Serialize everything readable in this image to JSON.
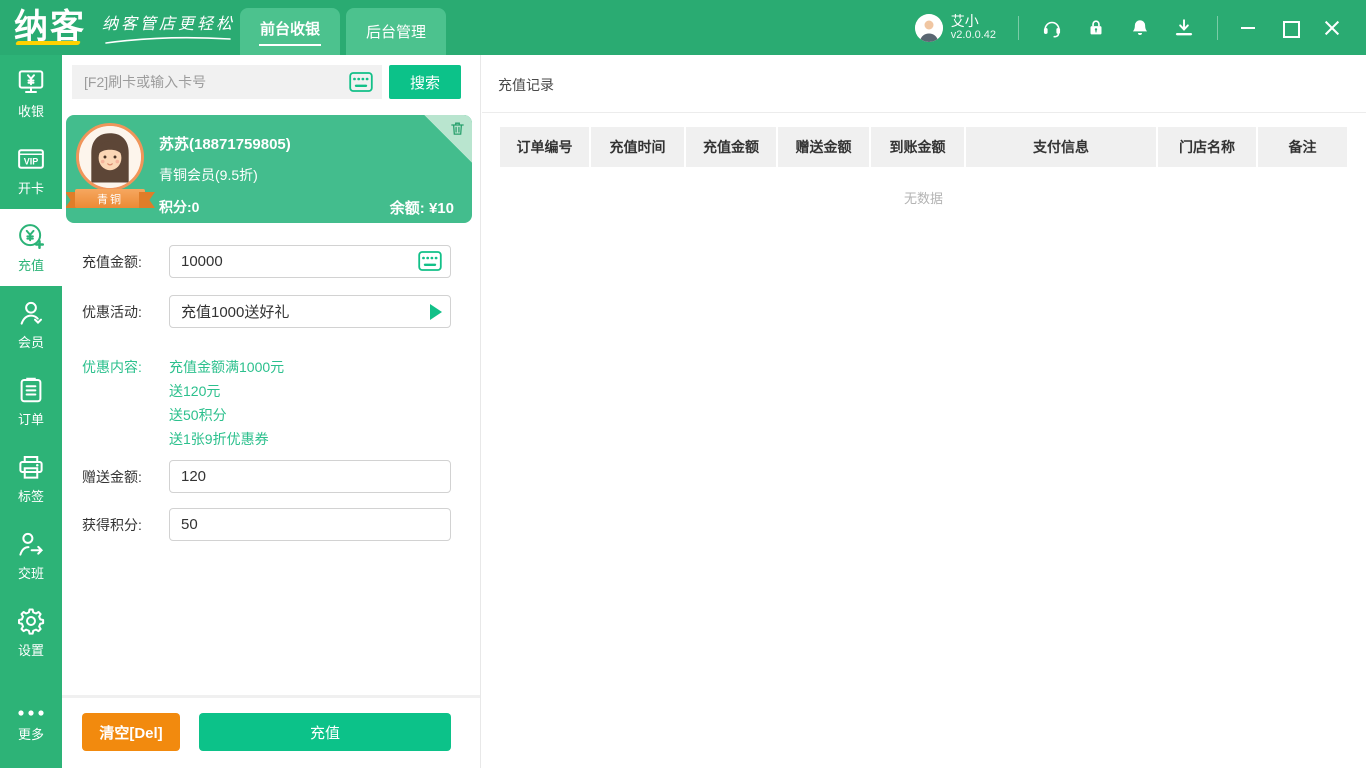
{
  "app": {
    "logo": "纳客",
    "slogan": "纳客管店更轻松",
    "tabs": [
      {
        "label": "前台收银"
      },
      {
        "label": "后台管理"
      }
    ],
    "user": {
      "name": "艾小",
      "version": "v2.0.0.42"
    }
  },
  "sidebar": {
    "items": [
      {
        "label": "收银"
      },
      {
        "label": "开卡"
      },
      {
        "label": "充值",
        "active": true
      },
      {
        "label": "会员"
      },
      {
        "label": "订单"
      },
      {
        "label": "标签"
      },
      {
        "label": "交班"
      },
      {
        "label": "设置"
      },
      {
        "label": "更多"
      }
    ]
  },
  "search": {
    "placeholder": "[F2]刷卡或输入卡号",
    "button_label": "搜索"
  },
  "member": {
    "name": "苏苏(18871759805)",
    "level": "青铜会员(9.5折)",
    "points": "积分:0",
    "balance": "余额: ¥10",
    "ribbon": "青铜"
  },
  "form": {
    "recharge_amount": {
      "label": "充值金额:",
      "value": "10000"
    },
    "promo": {
      "label": "优惠活动:",
      "value": "充值1000送好礼"
    },
    "promo_detail": {
      "label": "优惠内容:",
      "lines": [
        "充值金额满1000元",
        "送120元",
        "送50积分",
        "送1张9折优惠券"
      ]
    },
    "gift_amount": {
      "label": "赠送金额:",
      "value": "120"
    },
    "gain_points": {
      "label": "获得积分:",
      "value": "50"
    },
    "clear_label": "清空[Del]",
    "submit_label": "充值"
  },
  "records": {
    "title": "充值记录",
    "columns": [
      "订单编号",
      "充值时间",
      "充值金额",
      "赠送金额",
      "到账金额",
      "支付信息",
      "门店名称",
      "备注"
    ],
    "empty": "无数据"
  },
  "colors": {
    "topbar_green": "#2aab72",
    "sidebar_green": "#2db377",
    "tab_green": "#4cc28e",
    "card_green": "#43bd8d",
    "button_green": "#0cc289",
    "button_orange": "#f28a0e",
    "promo_text_green": "#2cc08d",
    "logo_yellow": "#ffd200",
    "table_header_bg": "#f0f0f0"
  }
}
